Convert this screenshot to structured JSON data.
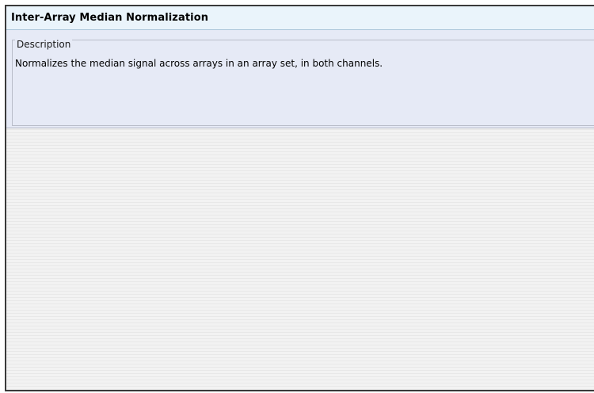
{
  "panel": {
    "title": "Inter-Array Median Normalization"
  },
  "description": {
    "legend": "Description",
    "text": "Normalizes the median signal across arrays in an array set, in both channels."
  }
}
